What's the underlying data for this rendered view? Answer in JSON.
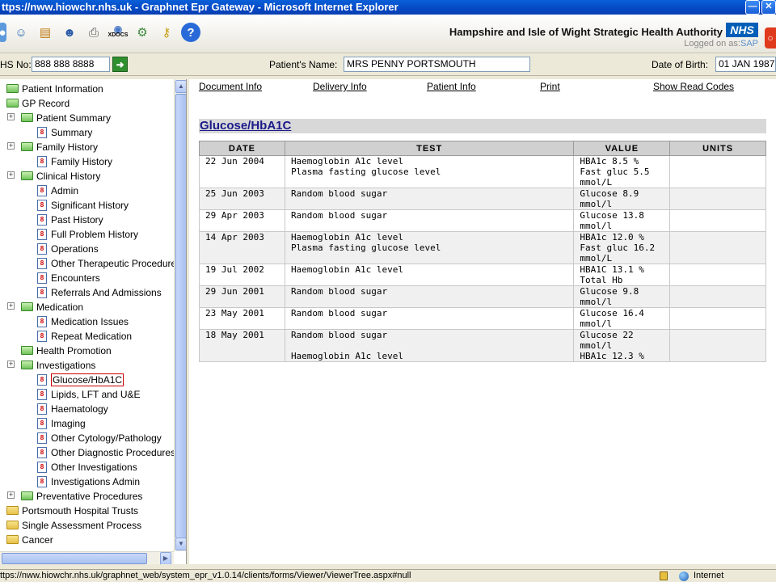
{
  "window": {
    "title": "ttps://nww.hiowchr.nhs.uk - Graphnet Epr Gateway - Microsoft Internet Explorer"
  },
  "toolbar": {
    "xdocs_label": "XDOCS",
    "organisation": "Hampshire and Isle of Wight Strategic Health Authority",
    "nhs_logo": "NHS",
    "logged_on_prefix": "Logged on as:",
    "logged_on_user": "SAP"
  },
  "patient": {
    "nhs_no_label": "HS No:",
    "nhs_no": "888 888 8888",
    "name_label": "Patient's Name:",
    "name": "MRS PENNY PORTSMOUTH",
    "dob_label": "Date of Birth:",
    "dob": "01 JAN 1987"
  },
  "tree": {
    "items": [
      {
        "label": "Patient Information",
        "type": "folder"
      },
      {
        "label": "GP Record",
        "type": "folder-open"
      },
      {
        "label": "Patient Summary",
        "type": "folder"
      },
      {
        "label": "Summary",
        "type": "doc"
      },
      {
        "label": "Family History",
        "type": "folder"
      },
      {
        "label": "Family History",
        "type": "doc"
      },
      {
        "label": "Clinical History",
        "type": "folder"
      },
      {
        "label": "Admin",
        "type": "doc"
      },
      {
        "label": "Significant History",
        "type": "doc"
      },
      {
        "label": "Past History",
        "type": "doc"
      },
      {
        "label": "Full Problem History",
        "type": "doc"
      },
      {
        "label": "Operations",
        "type": "doc"
      },
      {
        "label": "Other Therapeutic Procedures",
        "type": "doc"
      },
      {
        "label": "Encounters",
        "type": "doc"
      },
      {
        "label": "Referrals And Admissions",
        "type": "doc"
      },
      {
        "label": "Medication",
        "type": "folder"
      },
      {
        "label": "Medication Issues",
        "type": "doc"
      },
      {
        "label": "Repeat Medication",
        "type": "doc"
      },
      {
        "label": "Health Promotion",
        "type": "folder"
      },
      {
        "label": "Investigations",
        "type": "folder"
      },
      {
        "label": "Glucose/HbA1C",
        "type": "doc"
      },
      {
        "label": "Lipids, LFT and U&E",
        "type": "doc"
      },
      {
        "label": "Haematology",
        "type": "doc"
      },
      {
        "label": "Imaging",
        "type": "doc"
      },
      {
        "label": "Other Cytology/Pathology",
        "type": "doc"
      },
      {
        "label": "Other Diagnostic Procedures",
        "type": "doc"
      },
      {
        "label": "Other Investigations",
        "type": "doc"
      },
      {
        "label": "Investigations Admin",
        "type": "doc"
      },
      {
        "label": "Preventative Procedures",
        "type": "folder"
      },
      {
        "label": "Portsmouth Hospital Trusts",
        "type": "folder-plain"
      },
      {
        "label": "Single Assessment Process",
        "type": "folder-plain"
      },
      {
        "label": "Cancer",
        "type": "folder-plain"
      }
    ]
  },
  "content": {
    "links": {
      "document_info": "Document Info",
      "delivery_info": "Delivery Info",
      "patient_info": "Patient Info",
      "print": "Print",
      "show_read_codes": "Show Read Codes"
    },
    "section_title": "Glucose/HbA1C",
    "table": {
      "headers": [
        "DATE",
        "TEST",
        "VALUE",
        "UNITS"
      ],
      "rows": [
        {
          "date": "22 Jun 2004",
          "test": "Haemoglobin A1c level",
          "value": "HBA1c 8.5 %",
          "units": ""
        },
        {
          "date": "",
          "test": "Plasma fasting glucose level",
          "value": "Fast gluc 5.5 mmol/L",
          "units": ""
        },
        {
          "date": "25 Jun 2003",
          "test": "Random blood sugar",
          "value": "Glucose 8.9 mmol/l",
          "units": ""
        },
        {
          "date": "29 Apr 2003",
          "test": "Random blood sugar",
          "value": "Glucose 13.8 mmol/l",
          "units": ""
        },
        {
          "date": "14 Apr 2003",
          "test": "Haemoglobin A1c level",
          "value": "HBA1c 12.0 %",
          "units": ""
        },
        {
          "date": "",
          "test": "Plasma fasting glucose level",
          "value": "Fast gluc 16.2 mmol/L",
          "units": ""
        },
        {
          "date": "19 Jul 2002",
          "test": "Haemoglobin A1c level",
          "value": "HBA1C 13.1 % Total Hb",
          "units": ""
        },
        {
          "date": "29 Jun 2001",
          "test": "Random blood sugar",
          "value": "Glucose 9.8 mmol/l",
          "units": ""
        },
        {
          "date": "23 May 2001",
          "test": "Random blood sugar",
          "value": "Glucose 16.4 mmol/l",
          "units": ""
        },
        {
          "date": "18 May 2001",
          "test": "Random blood sugar",
          "value": "Glucose 22 mmol/l",
          "units": ""
        },
        {
          "date": "",
          "test": "Haemoglobin A1c level",
          "value": "HBA1c 12.3 %",
          "units": ""
        }
      ]
    }
  },
  "statusbar": {
    "url": "ttps://nww.hiowchr.nhs.uk/graphnet_web/system_epr_v1.0.14/clients/forms/Viewer/ViewerTree.aspx#null",
    "zone": "Internet"
  }
}
